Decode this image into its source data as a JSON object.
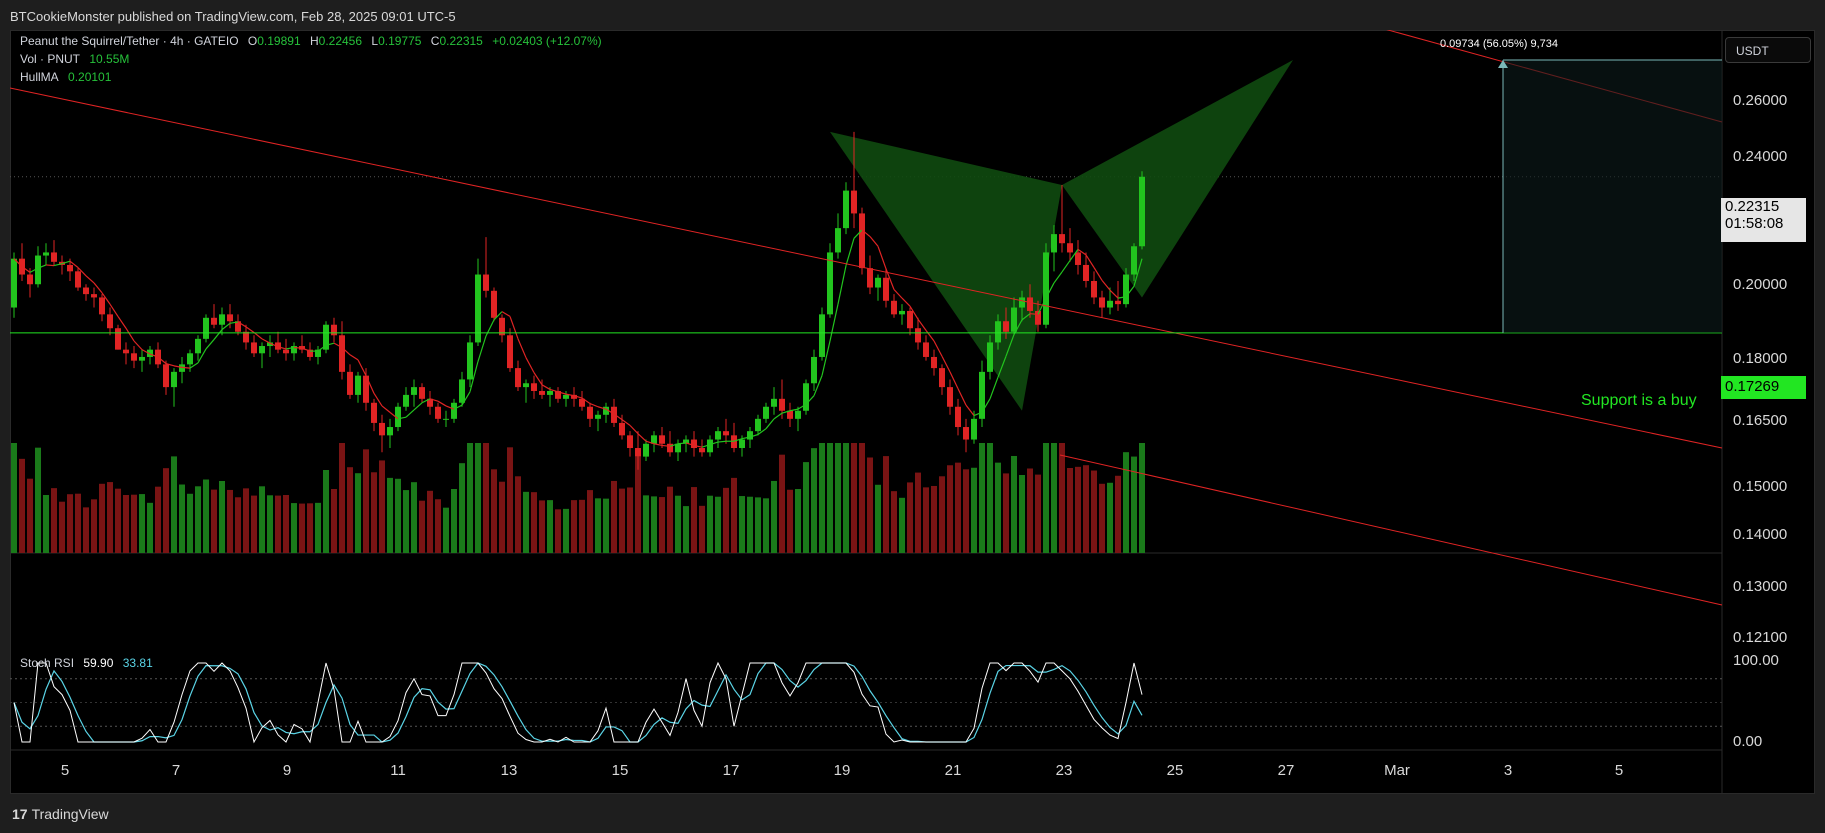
{
  "header": {
    "published": "BTCookieMonster published on TradingView.com, Feb 28, 2025 09:01 UTC-5"
  },
  "legend": {
    "symbol": "Peanut the Squirrel/Tether · 4h · GATEIO",
    "o_label": "O",
    "o": "0.19891",
    "h_label": "H",
    "h": "0.22456",
    "l_label": "L",
    "l": "0.19775",
    "c_label": "C",
    "c": "0.22315",
    "change": "+0.02403 (+12.07%)",
    "vol_label": "Vol · PNUT",
    "vol": "10.55M",
    "hull_label": "HullMA",
    "hull": "0.20101",
    "stoch_label": "Stoch RSI",
    "stoch_k": "59.90",
    "stoch_d": "33.81"
  },
  "currency": "USDT",
  "last_price": {
    "price": "0.22315",
    "countdown": "01:58:08"
  },
  "support_price": "0.17269",
  "support_text": "Support is a buy",
  "measure_text": "0.09734 (56.05%) 9,734",
  "price_axis": [
    "0.26000",
    "0.24000",
    "0.20000",
    "0.18000",
    "0.16500",
    "0.15000",
    "0.14000",
    "0.13000",
    "0.12100"
  ],
  "stoch_axis": [
    "100.00",
    "0.00"
  ],
  "time_axis": [
    "5",
    "7",
    "9",
    "11",
    "13",
    "15",
    "17",
    "19",
    "21",
    "23",
    "25",
    "27",
    "Mar",
    "3",
    "5"
  ],
  "footer": {
    "brand": "TradingView"
  },
  "colors": {
    "up": "#22c41e",
    "down": "#e02424",
    "volume_up": "#1a7a1a",
    "volume_down": "#7a1414",
    "hull_up": "#22c41e",
    "hull_down": "#e02424",
    "pattern": "#0f4a0f",
    "stoch_k": "#ffffff",
    "stoch_d": "#5ad4e6",
    "support_line": "#22e622",
    "trend_line": "#e02424"
  },
  "chart_data": {
    "type": "candlestick",
    "symbol": "PNUT/USDT",
    "interval": "4h",
    "x_range": [
      "Feb 5",
      "Mar 5"
    ],
    "ylim": [
      0.121,
      0.27
    ],
    "y_scale": "log",
    "candles": [
      [
        0.18,
        0.197,
        0.177,
        0.195
      ],
      [
        0.195,
        0.2,
        0.188,
        0.19
      ],
      [
        0.19,
        0.192,
        0.183,
        0.187
      ],
      [
        0.187,
        0.199,
        0.186,
        0.196
      ],
      [
        0.196,
        0.2,
        0.193,
        0.197
      ],
      [
        0.197,
        0.201,
        0.193,
        0.194
      ],
      [
        0.194,
        0.196,
        0.19,
        0.193
      ],
      [
        0.193,
        0.195,
        0.188,
        0.191
      ],
      [
        0.191,
        0.192,
        0.185,
        0.186
      ],
      [
        0.186,
        0.187,
        0.182,
        0.184
      ],
      [
        0.184,
        0.186,
        0.18,
        0.183
      ],
      [
        0.183,
        0.184,
        0.176,
        0.178
      ],
      [
        0.178,
        0.18,
        0.172,
        0.174
      ],
      [
        0.174,
        0.175,
        0.168,
        0.168
      ],
      [
        0.168,
        0.17,
        0.164,
        0.167
      ],
      [
        0.167,
        0.169,
        0.163,
        0.165
      ],
      [
        0.165,
        0.168,
        0.162,
        0.166
      ],
      [
        0.166,
        0.169,
        0.164,
        0.168
      ],
      [
        0.168,
        0.17,
        0.163,
        0.164
      ],
      [
        0.164,
        0.165,
        0.156,
        0.158
      ],
      [
        0.158,
        0.163,
        0.153,
        0.162
      ],
      [
        0.162,
        0.166,
        0.159,
        0.164
      ],
      [
        0.164,
        0.168,
        0.162,
        0.167
      ],
      [
        0.167,
        0.172,
        0.165,
        0.171
      ],
      [
        0.171,
        0.178,
        0.17,
        0.177
      ],
      [
        0.177,
        0.181,
        0.174,
        0.175
      ],
      [
        0.175,
        0.18,
        0.172,
        0.178
      ],
      [
        0.178,
        0.181,
        0.174,
        0.176
      ],
      [
        0.176,
        0.178,
        0.172,
        0.173
      ],
      [
        0.173,
        0.175,
        0.168,
        0.17
      ],
      [
        0.17,
        0.172,
        0.166,
        0.167
      ],
      [
        0.167,
        0.17,
        0.163,
        0.169
      ],
      [
        0.169,
        0.172,
        0.166,
        0.17
      ],
      [
        0.17,
        0.173,
        0.167,
        0.168
      ],
      [
        0.168,
        0.171,
        0.165,
        0.167
      ],
      [
        0.167,
        0.17,
        0.165,
        0.169
      ],
      [
        0.169,
        0.172,
        0.167,
        0.168
      ],
      [
        0.168,
        0.17,
        0.165,
        0.166
      ],
      [
        0.166,
        0.169,
        0.164,
        0.168
      ],
      [
        0.168,
        0.176,
        0.167,
        0.175
      ],
      [
        0.175,
        0.177,
        0.17,
        0.172
      ],
      [
        0.172,
        0.176,
        0.16,
        0.162
      ],
      [
        0.162,
        0.164,
        0.155,
        0.156
      ],
      [
        0.156,
        0.162,
        0.154,
        0.161
      ],
      [
        0.161,
        0.163,
        0.152,
        0.154
      ],
      [
        0.154,
        0.155,
        0.147,
        0.149
      ],
      [
        0.149,
        0.151,
        0.142,
        0.146
      ],
      [
        0.146,
        0.15,
        0.143,
        0.148
      ],
      [
        0.148,
        0.154,
        0.147,
        0.153
      ],
      [
        0.153,
        0.158,
        0.152,
        0.156
      ],
      [
        0.156,
        0.16,
        0.153,
        0.158
      ],
      [
        0.158,
        0.159,
        0.154,
        0.155
      ],
      [
        0.155,
        0.157,
        0.151,
        0.153
      ],
      [
        0.153,
        0.154,
        0.149,
        0.15
      ],
      [
        0.15,
        0.152,
        0.148,
        0.15
      ],
      [
        0.15,
        0.155,
        0.149,
        0.154
      ],
      [
        0.154,
        0.162,
        0.153,
        0.16
      ],
      [
        0.16,
        0.172,
        0.158,
        0.17
      ],
      [
        0.17,
        0.195,
        0.169,
        0.19
      ],
      [
        0.19,
        0.202,
        0.183,
        0.185
      ],
      [
        0.185,
        0.186,
        0.176,
        0.177
      ],
      [
        0.177,
        0.178,
        0.17,
        0.172
      ],
      [
        0.172,
        0.174,
        0.162,
        0.163
      ],
      [
        0.163,
        0.165,
        0.157,
        0.158
      ],
      [
        0.158,
        0.16,
        0.154,
        0.159
      ],
      [
        0.159,
        0.161,
        0.155,
        0.157
      ],
      [
        0.157,
        0.16,
        0.155,
        0.156
      ],
      [
        0.156,
        0.158,
        0.153,
        0.157
      ],
      [
        0.157,
        0.158,
        0.154,
        0.155
      ],
      [
        0.155,
        0.157,
        0.153,
        0.156
      ],
      [
        0.156,
        0.158,
        0.153,
        0.155
      ],
      [
        0.155,
        0.157,
        0.152,
        0.153
      ],
      [
        0.153,
        0.154,
        0.148,
        0.15
      ],
      [
        0.15,
        0.152,
        0.147,
        0.151
      ],
      [
        0.151,
        0.154,
        0.149,
        0.153
      ],
      [
        0.153,
        0.155,
        0.148,
        0.149
      ],
      [
        0.149,
        0.151,
        0.145,
        0.146
      ],
      [
        0.146,
        0.147,
        0.141,
        0.143
      ],
      [
        0.143,
        0.147,
        0.138,
        0.141
      ],
      [
        0.141,
        0.145,
        0.14,
        0.144
      ],
      [
        0.144,
        0.147,
        0.142,
        0.146
      ],
      [
        0.146,
        0.148,
        0.143,
        0.144
      ],
      [
        0.144,
        0.147,
        0.141,
        0.142
      ],
      [
        0.142,
        0.145,
        0.14,
        0.144
      ],
      [
        0.144,
        0.146,
        0.142,
        0.145
      ],
      [
        0.145,
        0.147,
        0.141,
        0.143
      ],
      [
        0.143,
        0.145,
        0.141,
        0.142
      ],
      [
        0.142,
        0.146,
        0.141,
        0.145
      ],
      [
        0.145,
        0.148,
        0.143,
        0.147
      ],
      [
        0.147,
        0.15,
        0.144,
        0.146
      ],
      [
        0.146,
        0.149,
        0.142,
        0.143
      ],
      [
        0.143,
        0.146,
        0.141,
        0.145
      ],
      [
        0.145,
        0.148,
        0.143,
        0.147
      ],
      [
        0.147,
        0.151,
        0.146,
        0.15
      ],
      [
        0.15,
        0.154,
        0.149,
        0.153
      ],
      [
        0.153,
        0.158,
        0.151,
        0.155
      ],
      [
        0.155,
        0.16,
        0.15,
        0.152
      ],
      [
        0.152,
        0.154,
        0.148,
        0.15
      ],
      [
        0.15,
        0.153,
        0.147,
        0.152
      ],
      [
        0.152,
        0.16,
        0.151,
        0.159
      ],
      [
        0.159,
        0.168,
        0.157,
        0.166
      ],
      [
        0.166,
        0.18,
        0.165,
        0.178
      ],
      [
        0.178,
        0.2,
        0.177,
        0.197
      ],
      [
        0.197,
        0.21,
        0.195,
        0.205
      ],
      [
        0.205,
        0.221,
        0.203,
        0.218
      ],
      [
        0.218,
        0.24,
        0.205,
        0.21
      ],
      [
        0.21,
        0.212,
        0.19,
        0.192
      ],
      [
        0.192,
        0.196,
        0.184,
        0.186
      ],
      [
        0.186,
        0.19,
        0.182,
        0.189
      ],
      [
        0.189,
        0.192,
        0.18,
        0.182
      ],
      [
        0.182,
        0.184,
        0.177,
        0.178
      ],
      [
        0.178,
        0.181,
        0.175,
        0.179
      ],
      [
        0.179,
        0.18,
        0.172,
        0.174
      ],
      [
        0.174,
        0.177,
        0.168,
        0.17
      ],
      [
        0.17,
        0.172,
        0.165,
        0.166
      ],
      [
        0.166,
        0.168,
        0.161,
        0.163
      ],
      [
        0.163,
        0.164,
        0.156,
        0.158
      ],
      [
        0.158,
        0.16,
        0.151,
        0.153
      ],
      [
        0.153,
        0.155,
        0.146,
        0.148
      ],
      [
        0.148,
        0.15,
        0.142,
        0.145
      ],
      [
        0.145,
        0.152,
        0.144,
        0.15
      ],
      [
        0.15,
        0.165,
        0.148,
        0.162
      ],
      [
        0.162,
        0.172,
        0.16,
        0.17
      ],
      [
        0.17,
        0.178,
        0.168,
        0.176
      ],
      [
        0.176,
        0.18,
        0.171,
        0.173
      ],
      [
        0.173,
        0.183,
        0.172,
        0.18
      ],
      [
        0.18,
        0.185,
        0.176,
        0.183
      ],
      [
        0.183,
        0.187,
        0.177,
        0.179
      ],
      [
        0.179,
        0.182,
        0.173,
        0.175
      ],
      [
        0.175,
        0.2,
        0.174,
        0.197
      ],
      [
        0.197,
        0.206,
        0.191,
        0.203
      ],
      [
        0.203,
        0.22,
        0.197,
        0.2
      ],
      [
        0.2,
        0.205,
        0.194,
        0.197
      ],
      [
        0.197,
        0.201,
        0.19,
        0.193
      ],
      [
        0.193,
        0.197,
        0.186,
        0.188
      ],
      [
        0.188,
        0.191,
        0.181,
        0.183
      ],
      [
        0.183,
        0.185,
        0.177,
        0.18
      ],
      [
        0.18,
        0.186,
        0.178,
        0.182
      ],
      [
        0.182,
        0.188,
        0.179,
        0.181
      ],
      [
        0.181,
        0.192,
        0.18,
        0.19
      ],
      [
        0.19,
        0.2,
        0.188,
        0.199
      ],
      [
        0.199,
        0.225,
        0.198,
        0.223
      ]
    ],
    "volume_bars": 142,
    "hull_ma_last": 0.20101,
    "support_level": 0.17269,
    "target_level": 0.27,
    "stoch_rsi": {
      "k_last": 59.9,
      "d_last": 33.81,
      "levels": [
        80,
        50,
        20
      ]
    }
  }
}
